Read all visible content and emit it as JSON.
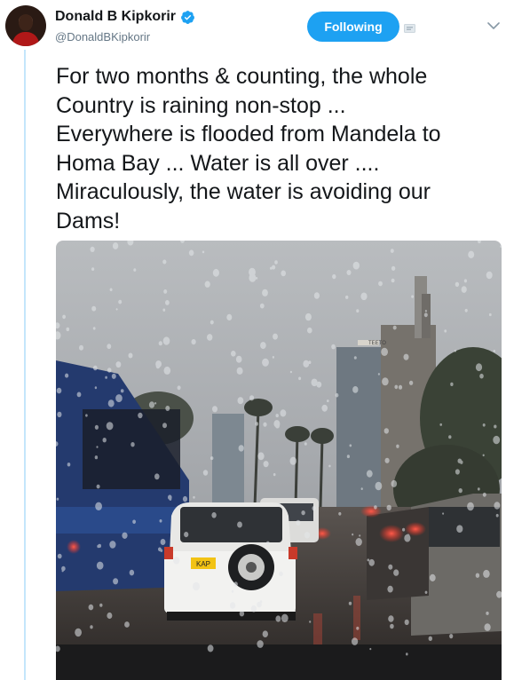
{
  "tweet": {
    "display_name": "Donald B Kipkorir",
    "handle": "@DonaldBKipkorir",
    "verified": true,
    "follow_button_label": "Following",
    "text": "For two months & counting, the whole\nCountry is raining non-stop ...\nEverywhere is flooded from Mandela to\nHoma Bay ... Water is all over ....\nMiraculously, the water is avoiding our\nDams!"
  },
  "photo": {
    "plate_text": "KAP",
    "building_sign": "TEETO"
  },
  "colors": {
    "accent": "#1da1f2",
    "thread_line": "#c4e6fb",
    "text": "#14171a",
    "secondary_text": "#657786"
  },
  "icons": {
    "verified": "verified-badge-icon",
    "block": "block-icon",
    "menu": "chevron-down-icon"
  }
}
